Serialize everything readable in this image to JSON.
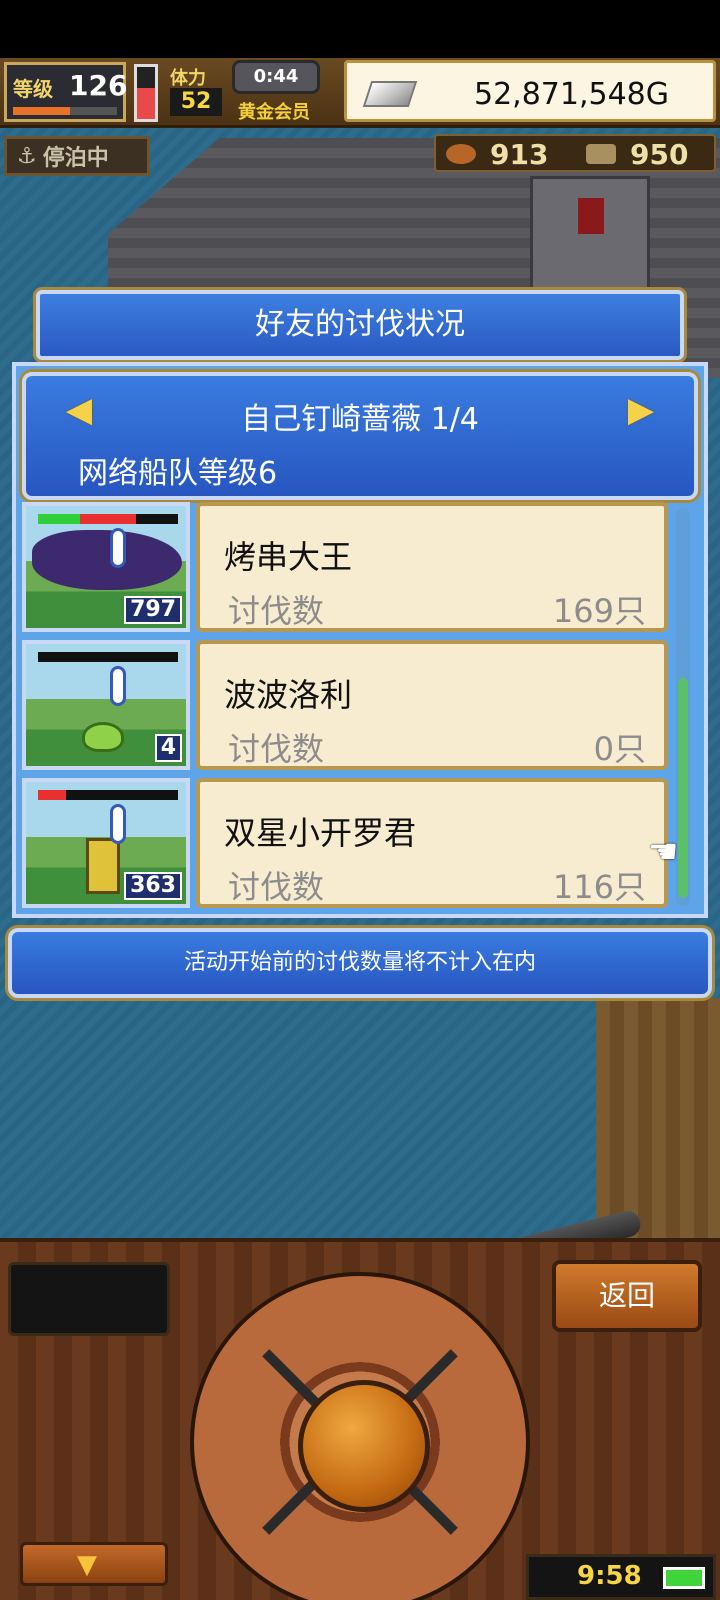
{
  "hud": {
    "level_label": "等级",
    "level_value": "126",
    "level_progress": 0.55,
    "hp_level": 0.6,
    "stamina_label": "体力",
    "stamina_value": "52",
    "timer": "0:44",
    "membership": "黄金会员",
    "gold": "52,871,548G",
    "dock_status": "停泊中",
    "food": "913",
    "wood": "950"
  },
  "dialog": {
    "title": "好友的讨伐状况",
    "player_name": "自己钉崎蔷薇 1/4",
    "fleet_level": "网络船队等级6",
    "prev_arrow": "◀",
    "next_arrow": "▶",
    "rows": [
      {
        "name": "烤串大王",
        "kill_label": "讨伐数",
        "kill_value": "169只",
        "thumb_count": "797",
        "hp_green": 0.3,
        "hp_red": 0.7
      },
      {
        "name": "波波洛利",
        "kill_label": "讨伐数",
        "kill_value": "0只",
        "thumb_count": "4",
        "hp_green": 0,
        "hp_red": 0
      },
      {
        "name": "双星小开罗君",
        "kill_label": "讨伐数",
        "kill_value": "116只",
        "thumb_count": "363",
        "hp_green": 0,
        "hp_red": 0.2
      }
    ],
    "notice": "活动开始前的讨伐数量将不计入在内"
  },
  "controls": {
    "back_label": "返回",
    "down_arrow": "▼",
    "clock": "9:58"
  },
  "colors": {
    "panel_blue": "#2a5ac4",
    "card_cream": "#f7ecd0",
    "gold_text": "#f7d545"
  }
}
